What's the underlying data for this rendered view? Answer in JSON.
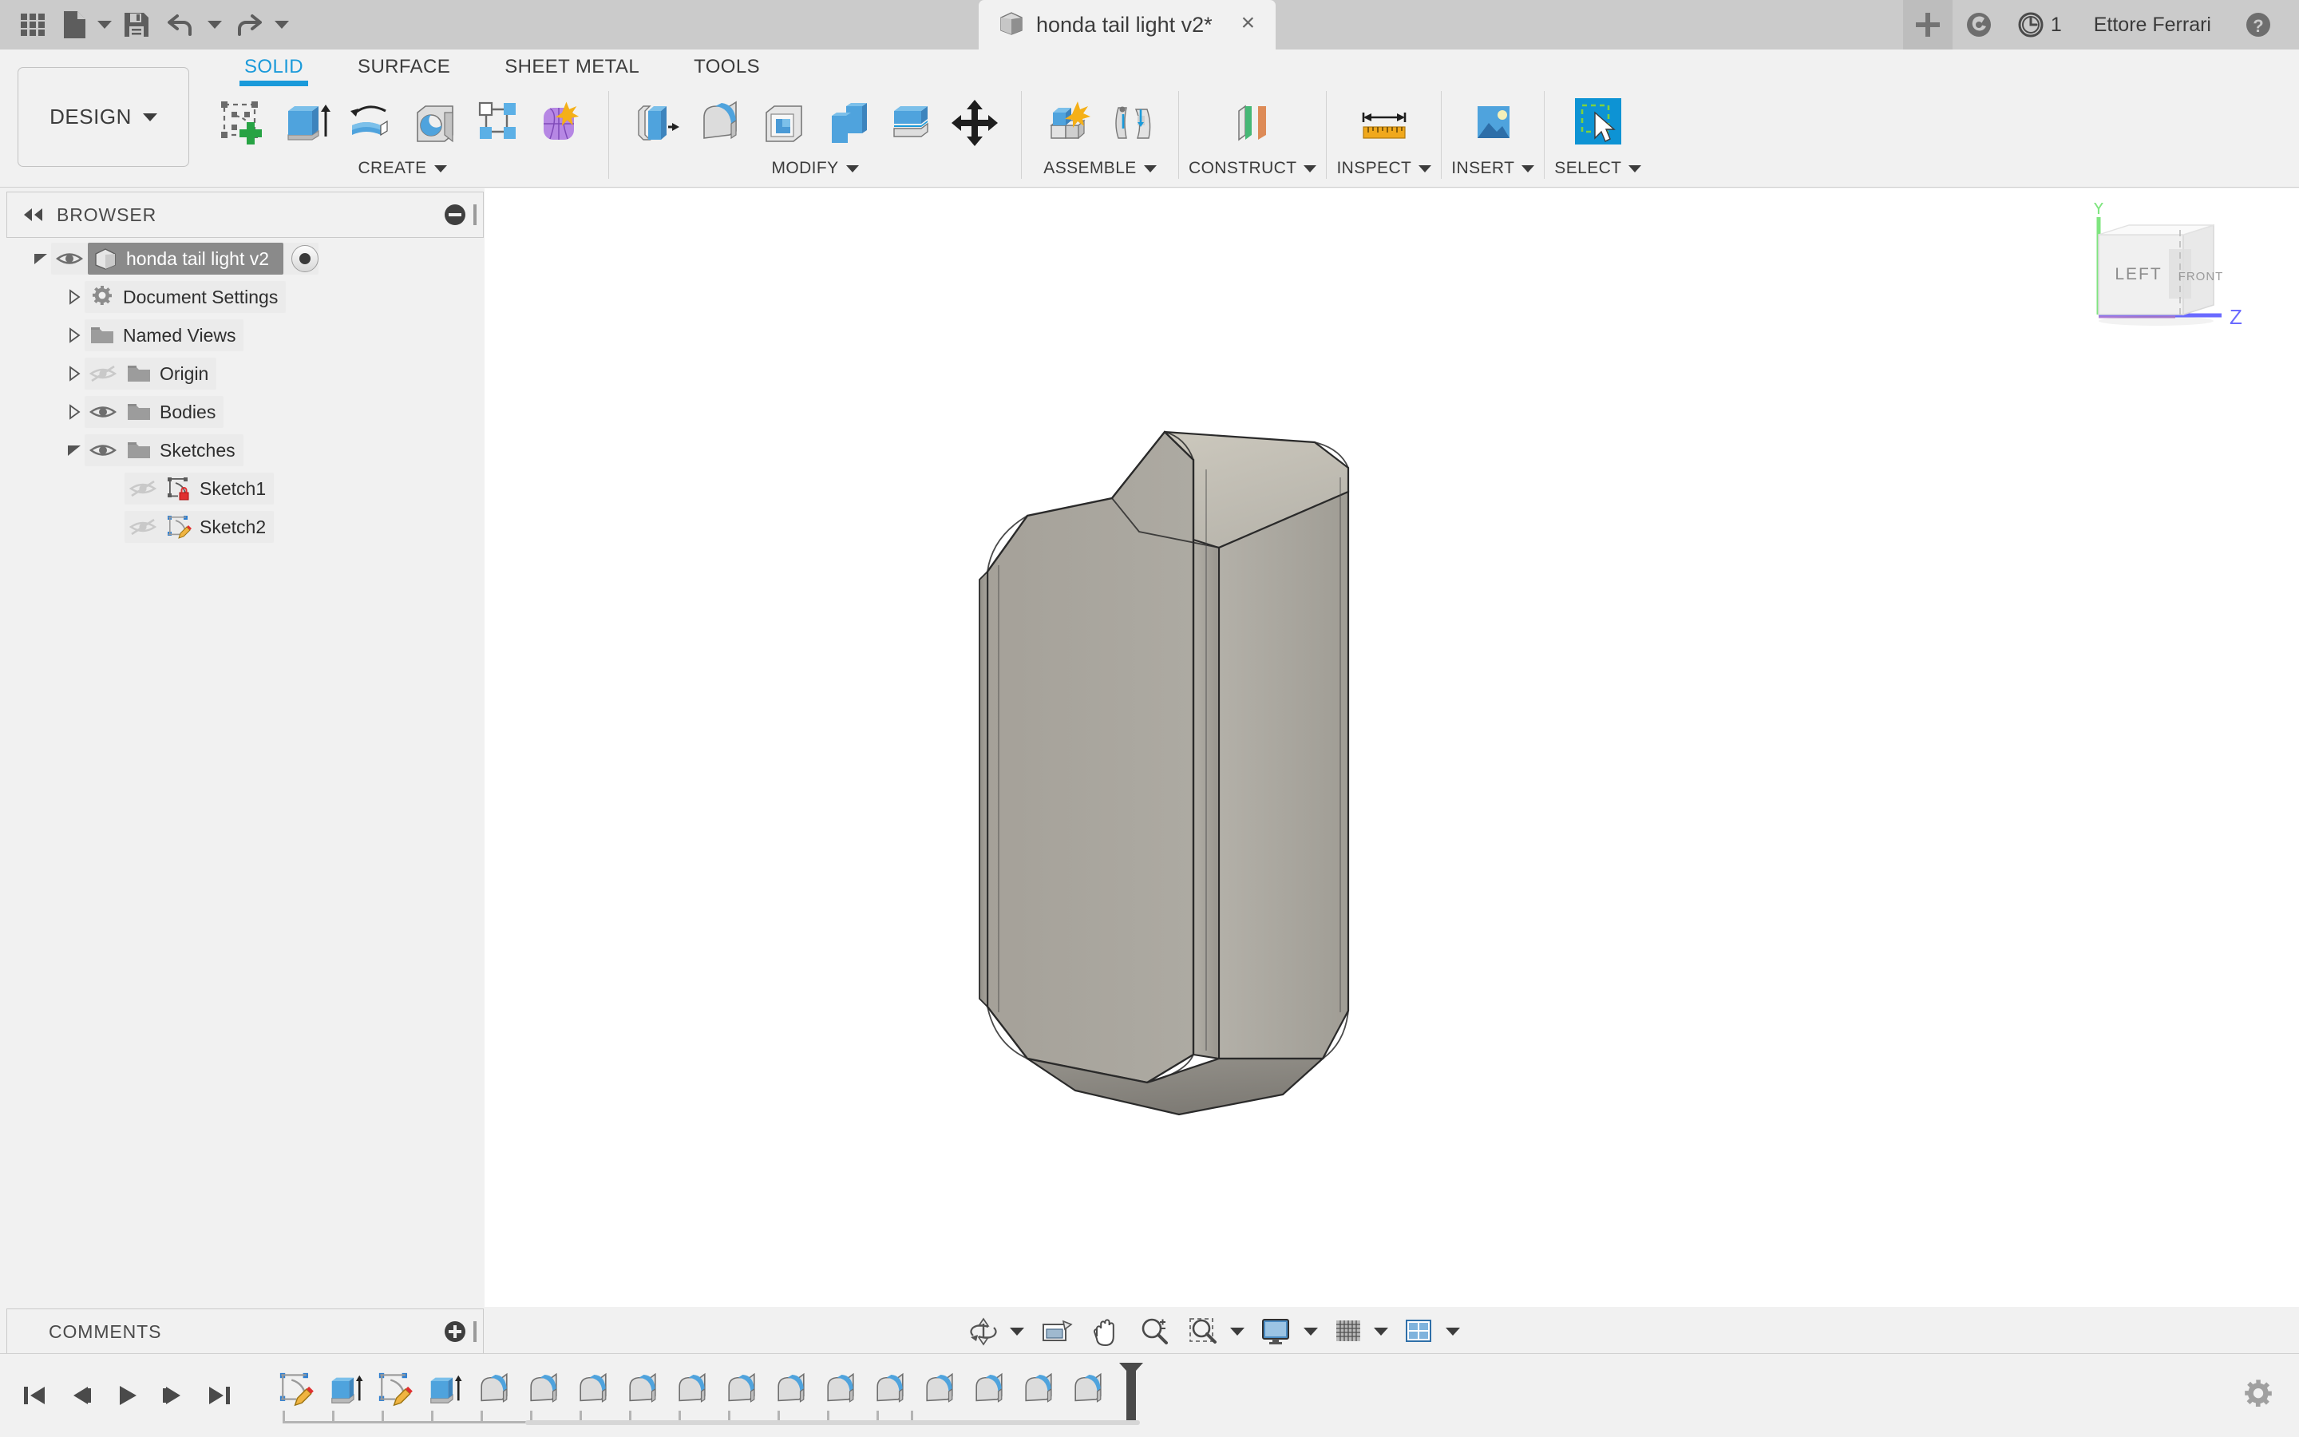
{
  "app": {
    "product": "Autodesk Fusion 360",
    "accent_blue": "#1a9ada",
    "titlebar_bg": "#cbcbcb",
    "panel_bg": "#f1f1f1",
    "canvas_bg": "#ffffff",
    "model_color": "#a8a49c"
  },
  "titlebar": {
    "quick_access": [
      {
        "name": "app-grid-icon",
        "label": "Show Data Panel"
      },
      {
        "name": "new-file-icon",
        "label": "File"
      },
      {
        "name": "save-icon",
        "label": "Save"
      },
      {
        "name": "undo-icon",
        "label": "Undo"
      },
      {
        "name": "redo-icon",
        "label": "Redo"
      }
    ],
    "document_title": "honda tail light v2*",
    "close_label": "×",
    "new_tab_label": "+",
    "job_status_label": "1",
    "user_name": "Ettore Ferrari",
    "help_label": "?"
  },
  "ribbon": {
    "design_workspace_label": "DESIGN",
    "tabs": [
      {
        "label": "SOLID",
        "active": true
      },
      {
        "label": "SURFACE",
        "active": false
      },
      {
        "label": "SHEET METAL",
        "active": false
      },
      {
        "label": "TOOLS",
        "active": false
      }
    ],
    "panels": [
      {
        "label": "CREATE",
        "has_dropdown": true,
        "tools": [
          {
            "name": "create-sketch-icon",
            "label": "Create Sketch"
          },
          {
            "name": "extrude-icon",
            "label": "Extrude"
          },
          {
            "name": "revolve-icon",
            "label": "Revolve"
          },
          {
            "name": "hole-icon",
            "label": "Hole"
          },
          {
            "name": "rectangular-pattern-icon",
            "label": "Rectangular Pattern"
          },
          {
            "name": "form-icon",
            "label": "Create Form"
          }
        ]
      },
      {
        "label": "MODIFY",
        "has_dropdown": true,
        "tools": [
          {
            "name": "press-pull-icon",
            "label": "Press Pull"
          },
          {
            "name": "fillet-icon",
            "label": "Fillet"
          },
          {
            "name": "shell-icon",
            "label": "Shell"
          },
          {
            "name": "combine-icon",
            "label": "Combine"
          },
          {
            "name": "split-face-icon",
            "label": "Split Face"
          },
          {
            "name": "move-copy-icon",
            "label": "Move/Copy"
          }
        ]
      },
      {
        "label": "ASSEMBLE",
        "has_dropdown": true,
        "tools": [
          {
            "name": "new-component-icon",
            "label": "New Component"
          },
          {
            "name": "joint-icon",
            "label": "Joint"
          }
        ]
      },
      {
        "label": "CONSTRUCT",
        "has_dropdown": true,
        "tools": [
          {
            "name": "offset-plane-icon",
            "label": "Offset Plane"
          }
        ]
      },
      {
        "label": "INSPECT",
        "has_dropdown": true,
        "tools": [
          {
            "name": "measure-icon",
            "label": "Measure"
          }
        ]
      },
      {
        "label": "INSERT",
        "has_dropdown": true,
        "tools": [
          {
            "name": "insert-image-icon",
            "label": "Canvas"
          }
        ]
      },
      {
        "label": "SELECT",
        "has_dropdown": true,
        "tools": [
          {
            "name": "select-icon",
            "label": "Select"
          }
        ]
      }
    ]
  },
  "browser": {
    "title": "BROWSER",
    "collapse_icon": "collapse-left-icon",
    "minimize_icon": "minimize-icon",
    "tree": [
      {
        "label": "honda tail light v2",
        "depth": 0,
        "expanded": true,
        "visible": true,
        "selected": true,
        "icon": "component-icon",
        "has_activate_radio": true
      },
      {
        "label": "Document Settings",
        "depth": 1,
        "expanded": false,
        "visible": null,
        "selected": false,
        "icon": "gear-icon",
        "has_activate_radio": false
      },
      {
        "label": "Named Views",
        "depth": 1,
        "expanded": false,
        "visible": null,
        "selected": false,
        "icon": "folder-icon",
        "has_activate_radio": false
      },
      {
        "label": "Origin",
        "depth": 1,
        "expanded": false,
        "visible": false,
        "selected": false,
        "icon": "folder-icon",
        "has_activate_radio": false
      },
      {
        "label": "Bodies",
        "depth": 1,
        "expanded": false,
        "visible": true,
        "selected": false,
        "icon": "folder-icon",
        "has_activate_radio": false
      },
      {
        "label": "Sketches",
        "depth": 1,
        "expanded": true,
        "visible": true,
        "selected": false,
        "icon": "folder-icon",
        "has_activate_radio": false
      },
      {
        "label": "Sketch1",
        "depth": 2,
        "expanded": null,
        "visible": false,
        "selected": false,
        "icon": "sketch-locked-icon",
        "has_activate_radio": false
      },
      {
        "label": "Sketch2",
        "depth": 2,
        "expanded": null,
        "visible": false,
        "selected": false,
        "icon": "sketch-edit-icon",
        "has_activate_radio": false
      }
    ]
  },
  "comments": {
    "title": "COMMENTS",
    "add_icon": "add-comment-icon"
  },
  "viewcube": {
    "front_face_label": "FRONT",
    "left_face_label": "LEFT",
    "axis_y_label": "Y",
    "axis_z_label": "Z",
    "axis_y_color": "#7fe57f",
    "axis_z_color": "#6a6aff"
  },
  "navbar": {
    "items": [
      {
        "name": "orbit-icon",
        "label": "Orbit",
        "has_dropdown": true
      },
      {
        "name": "look-at-icon",
        "label": "Look At",
        "has_dropdown": false
      },
      {
        "name": "pan-icon",
        "label": "Pan",
        "has_dropdown": false
      },
      {
        "name": "zoom-icon",
        "label": "Zoom",
        "has_dropdown": false
      },
      {
        "name": "zoom-window-icon",
        "label": "Fit",
        "has_dropdown": true
      },
      {
        "name": "display-settings-icon",
        "label": "Display Settings",
        "has_dropdown": true
      },
      {
        "name": "grid-snaps-icon",
        "label": "Grid and Snaps",
        "has_dropdown": true
      },
      {
        "name": "viewports-icon",
        "label": "Viewports",
        "has_dropdown": true
      }
    ]
  },
  "timeline": {
    "playback": [
      {
        "name": "go-to-beginning-icon",
        "label": "Go to beginning"
      },
      {
        "name": "step-back-icon",
        "label": "Step back"
      },
      {
        "name": "play-icon",
        "label": "Play"
      },
      {
        "name": "step-forward-icon",
        "label": "Step forward"
      },
      {
        "name": "go-to-end-icon",
        "label": "Go to end"
      }
    ],
    "features": [
      {
        "name": "timeline-sketch-icon",
        "label": "Sketch1",
        "type": "sketch"
      },
      {
        "name": "timeline-extrude-icon",
        "label": "Extrude1",
        "type": "extrude"
      },
      {
        "name": "timeline-sketch-icon",
        "label": "Sketch2",
        "type": "sketch"
      },
      {
        "name": "timeline-extrude-icon",
        "label": "Extrude2",
        "type": "extrude"
      },
      {
        "name": "timeline-fillet-icon",
        "label": "Fillet1",
        "type": "fillet"
      },
      {
        "name": "timeline-fillet-icon",
        "label": "Fillet2",
        "type": "fillet"
      },
      {
        "name": "timeline-fillet-icon",
        "label": "Fillet3",
        "type": "fillet"
      },
      {
        "name": "timeline-fillet-icon",
        "label": "Fillet4",
        "type": "fillet"
      },
      {
        "name": "timeline-fillet-icon",
        "label": "Fillet5",
        "type": "fillet"
      },
      {
        "name": "timeline-fillet-icon",
        "label": "Fillet6",
        "type": "fillet"
      },
      {
        "name": "timeline-fillet-icon",
        "label": "Fillet7",
        "type": "fillet"
      },
      {
        "name": "timeline-fillet-icon",
        "label": "Fillet8",
        "type": "fillet"
      },
      {
        "name": "timeline-fillet-icon",
        "label": "Fillet9",
        "type": "fillet"
      },
      {
        "name": "timeline-fillet-icon",
        "label": "Fillet10",
        "type": "fillet"
      },
      {
        "name": "timeline-fillet-icon",
        "label": "Fillet11",
        "type": "fillet"
      },
      {
        "name": "timeline-fillet-icon",
        "label": "Fillet12",
        "type": "fillet"
      },
      {
        "name": "timeline-fillet-icon",
        "label": "Fillet13",
        "type": "fillet"
      }
    ],
    "marker_position": "end",
    "settings_icon": "gear-icon"
  }
}
